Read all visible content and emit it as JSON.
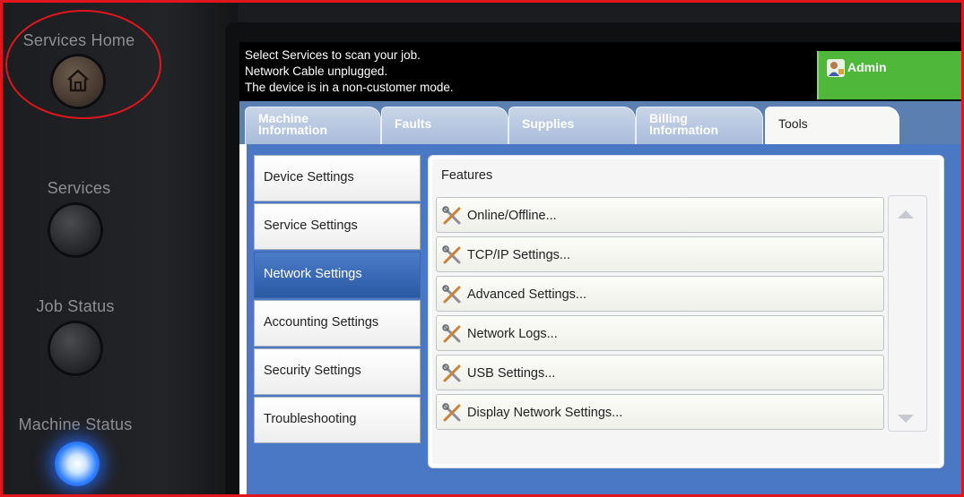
{
  "panel": {
    "home_label": "Services Home",
    "services_label": "Services",
    "job_status_label": "Job Status",
    "machine_status_label": "Machine Status",
    "highlight_color": "#e0161c",
    "status_light_color": "#2f80ff"
  },
  "screen": {
    "messages": [
      "Select Services to scan your job.",
      "Network Cable unplugged.",
      "The device is in a non-customer mode."
    ],
    "admin_label": "Admin",
    "admin_color": "#4fb83a",
    "tabs": [
      {
        "line1": "Machine",
        "line2": "Information"
      },
      {
        "line1": "Faults",
        "line2": ""
      },
      {
        "line1": "Supplies",
        "line2": ""
      },
      {
        "line1": "Billing",
        "line2": "Information"
      },
      {
        "line1": "Tools",
        "line2": ""
      }
    ],
    "active_tab": "Tools",
    "menu": [
      "Device Settings",
      "Service Settings",
      "Network Settings",
      "Accounting Settings",
      "Security Settings",
      "Troubleshooting"
    ],
    "active_menu": "Network Settings",
    "features_title": "Features",
    "features": [
      "Online/Offline...",
      "TCP/IP Settings...",
      "Advanced Settings...",
      "Network Logs...",
      "USB Settings...",
      "Display Network Settings..."
    ],
    "feature_icon": "tools-icon",
    "accent_color": "#4a78c4"
  }
}
